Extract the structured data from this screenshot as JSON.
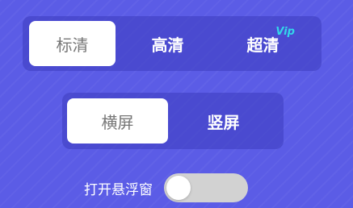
{
  "quality": {
    "options": [
      {
        "label": "标清",
        "selected": true
      },
      {
        "label": "高清",
        "selected": false
      },
      {
        "label": "超清",
        "selected": false,
        "badge": "VIP"
      }
    ]
  },
  "orientation": {
    "options": [
      {
        "label": "横屏",
        "selected": true
      },
      {
        "label": "竖屏",
        "selected": false
      }
    ]
  },
  "float_window": {
    "label": "打开悬浮窗",
    "enabled": false
  },
  "colors": {
    "background": "#5b5ce6",
    "selected_segment": "#ffffff",
    "vip_badge": "#33d6ea",
    "toggle_off": "#d2d2d2"
  }
}
